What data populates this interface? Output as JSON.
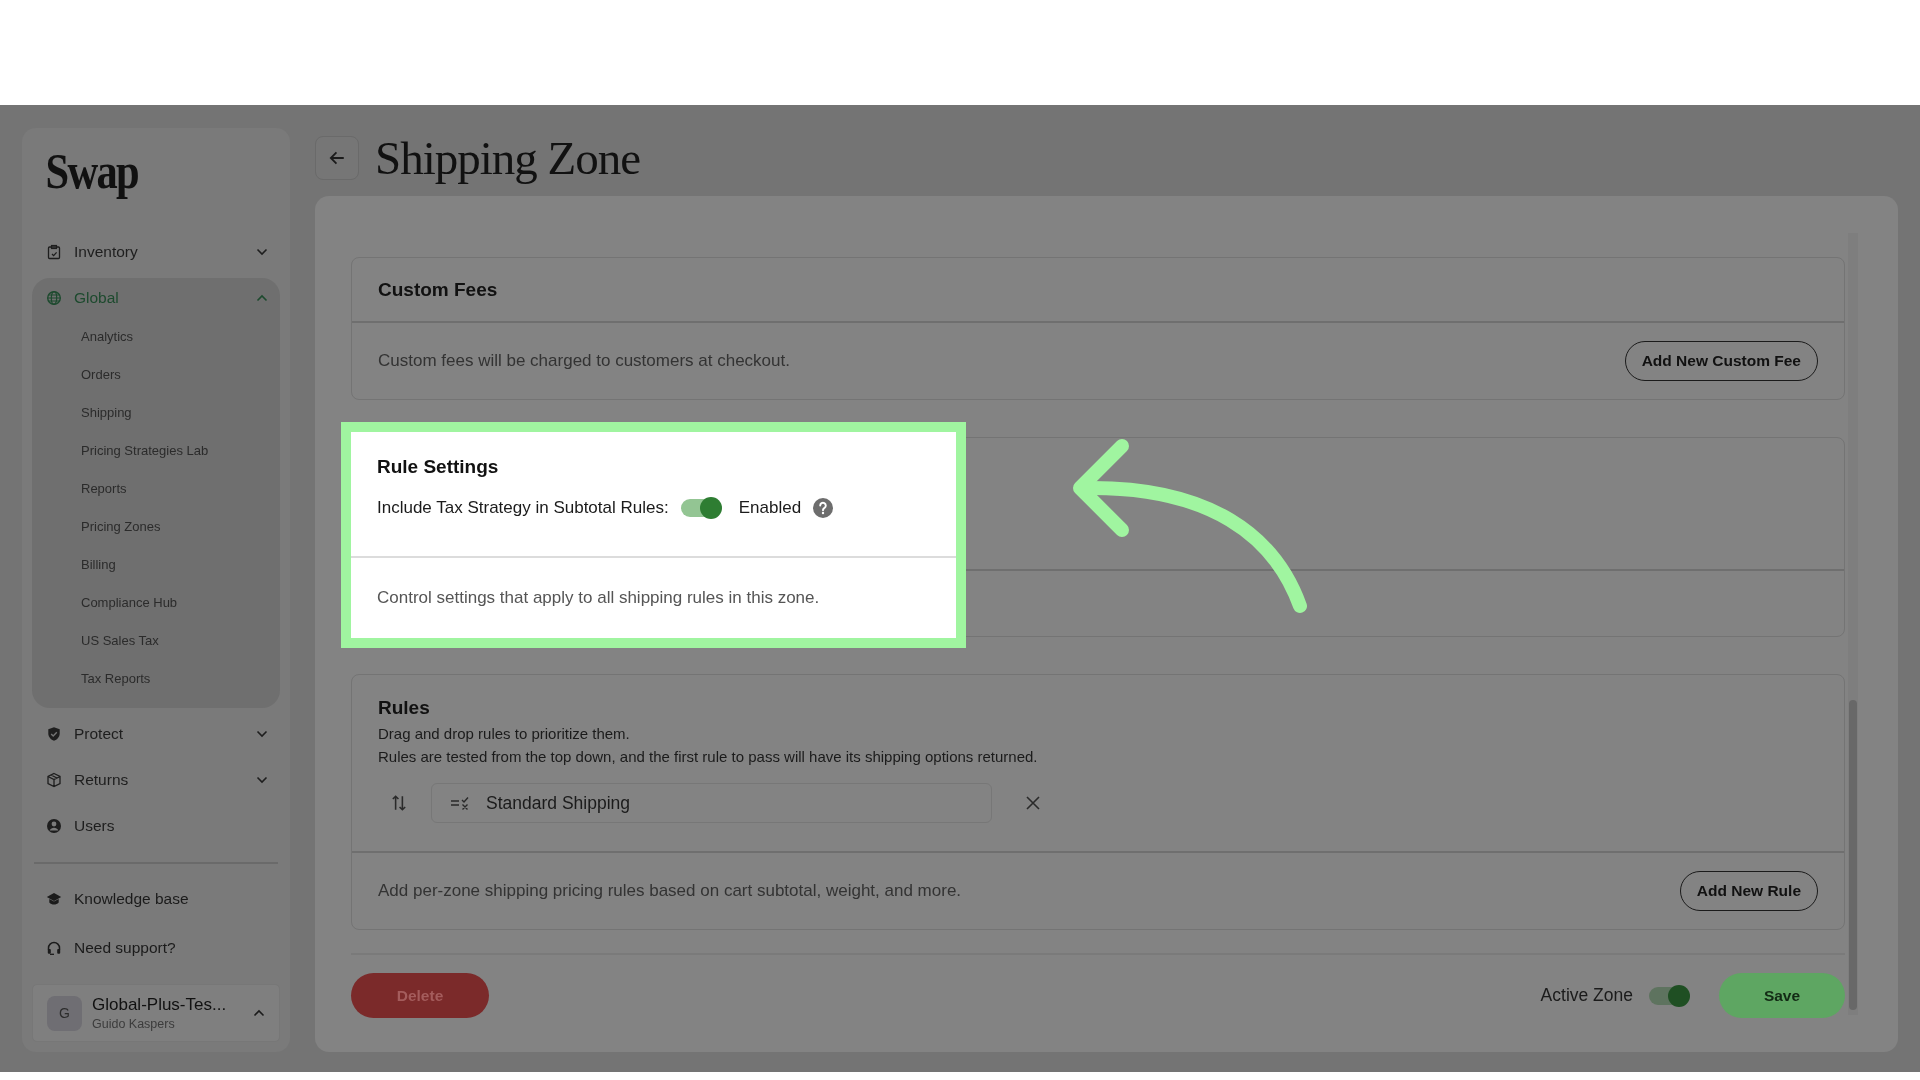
{
  "sidebar": {
    "logo": "Swap",
    "items": [
      {
        "label": "Inventory",
        "selected": false,
        "expanded": false
      },
      {
        "label": "Global",
        "selected": true,
        "expanded": true,
        "children": [
          {
            "label": "Analytics",
            "selected": false
          },
          {
            "label": "Orders",
            "selected": false
          },
          {
            "label": "Shipping",
            "selected": false
          },
          {
            "label": "Pricing Strategies Lab",
            "selected": false
          },
          {
            "label": "Reports",
            "selected": false
          },
          {
            "label": "Pricing Zones",
            "selected": false
          },
          {
            "label": "Billing",
            "selected": false
          },
          {
            "label": "Compliance Hub",
            "selected": false
          },
          {
            "label": "US Sales Tax",
            "selected": false
          },
          {
            "label": "Tax Reports",
            "selected": false
          }
        ]
      },
      {
        "label": "Protect",
        "selected": false,
        "expanded": false
      },
      {
        "label": "Returns",
        "selected": false,
        "expanded": false
      },
      {
        "label": "Users",
        "selected": false
      }
    ],
    "footer_links": [
      {
        "label": "Knowledge base"
      },
      {
        "label": "Need support?"
      }
    ],
    "account": {
      "initial": "G",
      "name": "Global-Plus-Tes...",
      "user": "Guido Kaspers",
      "expanded": true
    }
  },
  "page": {
    "title": "Shipping Zone"
  },
  "custom_fees": {
    "title": "Custom Fees",
    "description": "Custom fees will be charged to customers at checkout.",
    "button": "Add New Custom Fee"
  },
  "rule_settings": {
    "title": "Rule Settings",
    "setting_label": "Include Tax Strategy in Subtotal Rules:",
    "on": true,
    "state_text": "Enabled",
    "description": "Control settings that apply to all shipping rules in this zone."
  },
  "rules": {
    "title": "Rules",
    "hint_1": "Drag and drop rules to prioritize them.",
    "hint_2": "Rules are tested from the top down, and the first rule to pass will have its shipping options returned.",
    "items": [
      {
        "name": "Standard Shipping"
      }
    ],
    "description": "Add per-zone shipping pricing rules based on cart subtotal, weight, and more.",
    "button": "Add New Rule"
  },
  "footer": {
    "delete": "Delete",
    "active_label": "Active Zone",
    "active": true,
    "save": "Save"
  }
}
